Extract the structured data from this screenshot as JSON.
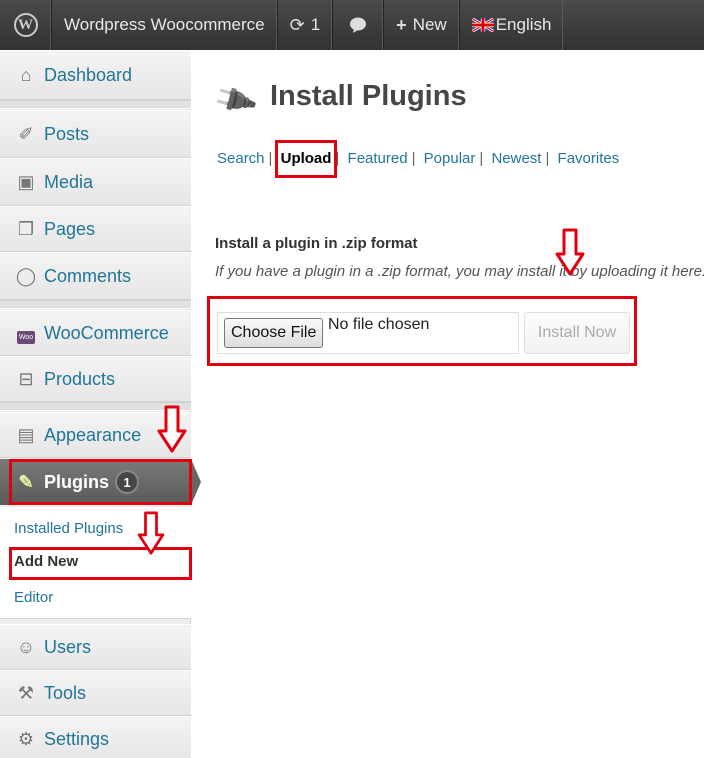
{
  "admin_bar": {
    "wp_logo": "W",
    "site_name": "Wordpress Woocommerce",
    "updates_count": "1",
    "new_label": "New",
    "language": "English"
  },
  "sidebar": {
    "items": [
      {
        "label": "Dashboard",
        "icon": "home-icon"
      },
      {
        "label": "Posts",
        "icon": "pushpin-icon"
      },
      {
        "label": "Media",
        "icon": "media-icon"
      },
      {
        "label": "Pages",
        "icon": "pages-icon"
      },
      {
        "label": "Comments",
        "icon": "comment-icon"
      },
      {
        "label": "WooCommerce",
        "icon": "woo-icon",
        "icon_text": "Woo"
      },
      {
        "label": "Products",
        "icon": "products-icon"
      },
      {
        "label": "Appearance",
        "icon": "appearance-icon"
      },
      {
        "label": "Plugins",
        "icon": "plugin-icon",
        "badge": "1",
        "active": true
      },
      {
        "label": "Users",
        "icon": "users-icon"
      },
      {
        "label": "Tools",
        "icon": "tools-icon"
      },
      {
        "label": "Settings",
        "icon": "settings-icon"
      }
    ],
    "plugins_submenu": [
      {
        "label": "Installed Plugins"
      },
      {
        "label": "Add New",
        "current": true
      },
      {
        "label": "Editor"
      }
    ]
  },
  "main": {
    "title": "Install Plugins",
    "tabs": [
      {
        "label": "Search"
      },
      {
        "label": "Upload",
        "current": true
      },
      {
        "label": "Featured"
      },
      {
        "label": "Popular"
      },
      {
        "label": "Newest"
      },
      {
        "label": "Favorites"
      }
    ],
    "section_title": "Install a plugin in .zip format",
    "help_text": "If you have a plugin in a .zip format, you may install it by uploading it here.",
    "choose_file_label": "Choose File",
    "no_file_text": "No file chosen",
    "install_button_label": "Install Now"
  },
  "colors": {
    "annotation_red": "#e0000f",
    "link_blue": "#21759b",
    "admin_bar": "#3a3a3a"
  }
}
